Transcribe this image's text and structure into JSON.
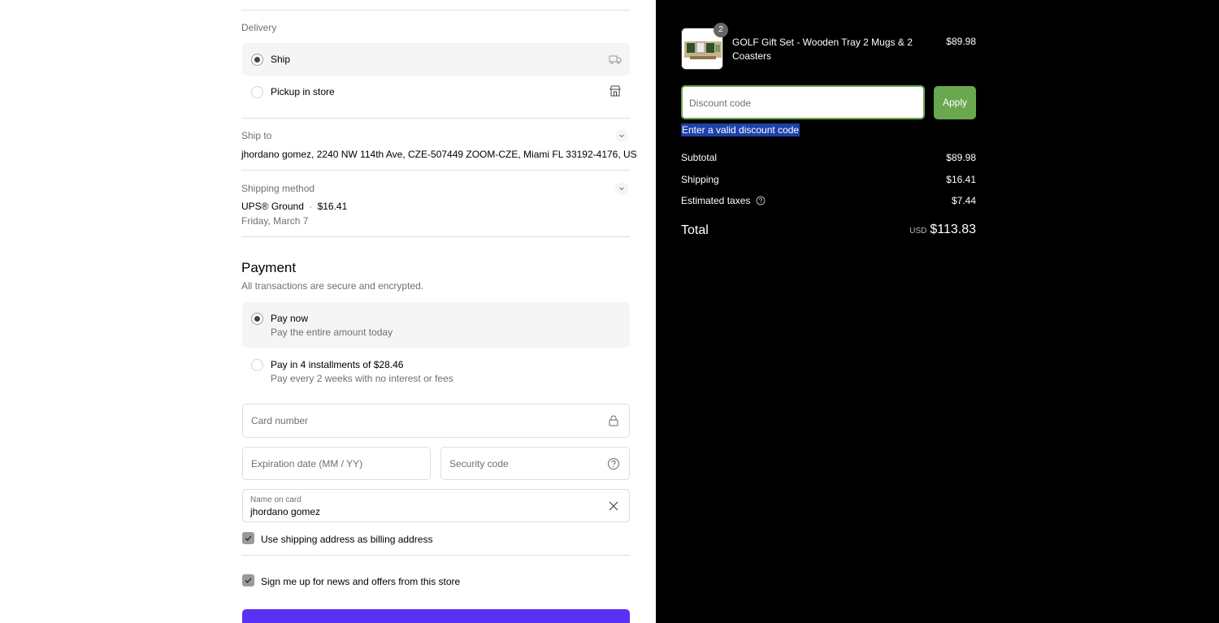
{
  "delivery": {
    "label": "Delivery",
    "options": [
      {
        "label": "Ship",
        "selected": true,
        "icon": "truck-icon"
      },
      {
        "label": "Pickup in store",
        "selected": false,
        "icon": "store-icon"
      }
    ]
  },
  "ship_to": {
    "label": "Ship to",
    "address": "jhordano gomez, 2240 NW 114th Ave, CZE-507449 ZOOM-CZE, Miami FL 33192-4176, US"
  },
  "shipping_method": {
    "label": "Shipping method",
    "carrier": "UPS® Ground",
    "separator": "·",
    "price": "$16.41",
    "date": "Friday, March 7"
  },
  "payment": {
    "title": "Payment",
    "subtitle": "All transactions are secure and encrypted.",
    "options": [
      {
        "title": "Pay now",
        "subtitle": "Pay the entire amount today",
        "selected": true
      },
      {
        "title": "Pay in 4 installments of $28.46",
        "subtitle": "Pay every 2 weeks with no interest or fees",
        "selected": false
      }
    ],
    "card_number_placeholder": "Card number",
    "expiration_placeholder": "Expiration date (MM / YY)",
    "security_placeholder": "Security code",
    "name_label": "Name on card",
    "name_value": "jhordano gomez",
    "billing_checkbox": "Use shipping address as billing address",
    "newsletter_checkbox": "Sign me up for news and offers from this store",
    "pay_button_color": "#5a31f4"
  },
  "summary": {
    "product": {
      "name": "GOLF Gift Set - Wooden Tray 2 Mugs & 2 Coasters",
      "quantity": "2",
      "price": "$89.98"
    },
    "discount_placeholder": "Discount code",
    "apply_label": "Apply",
    "error": "Enter a valid discount code",
    "subtotal_label": "Subtotal",
    "subtotal": "$89.98",
    "shipping_label": "Shipping",
    "shipping": "$16.41",
    "taxes_label": "Estimated taxes",
    "taxes": "$7.44",
    "total_label": "Total",
    "currency": "USD",
    "total": "$113.83",
    "accent": "#6aa84f"
  }
}
